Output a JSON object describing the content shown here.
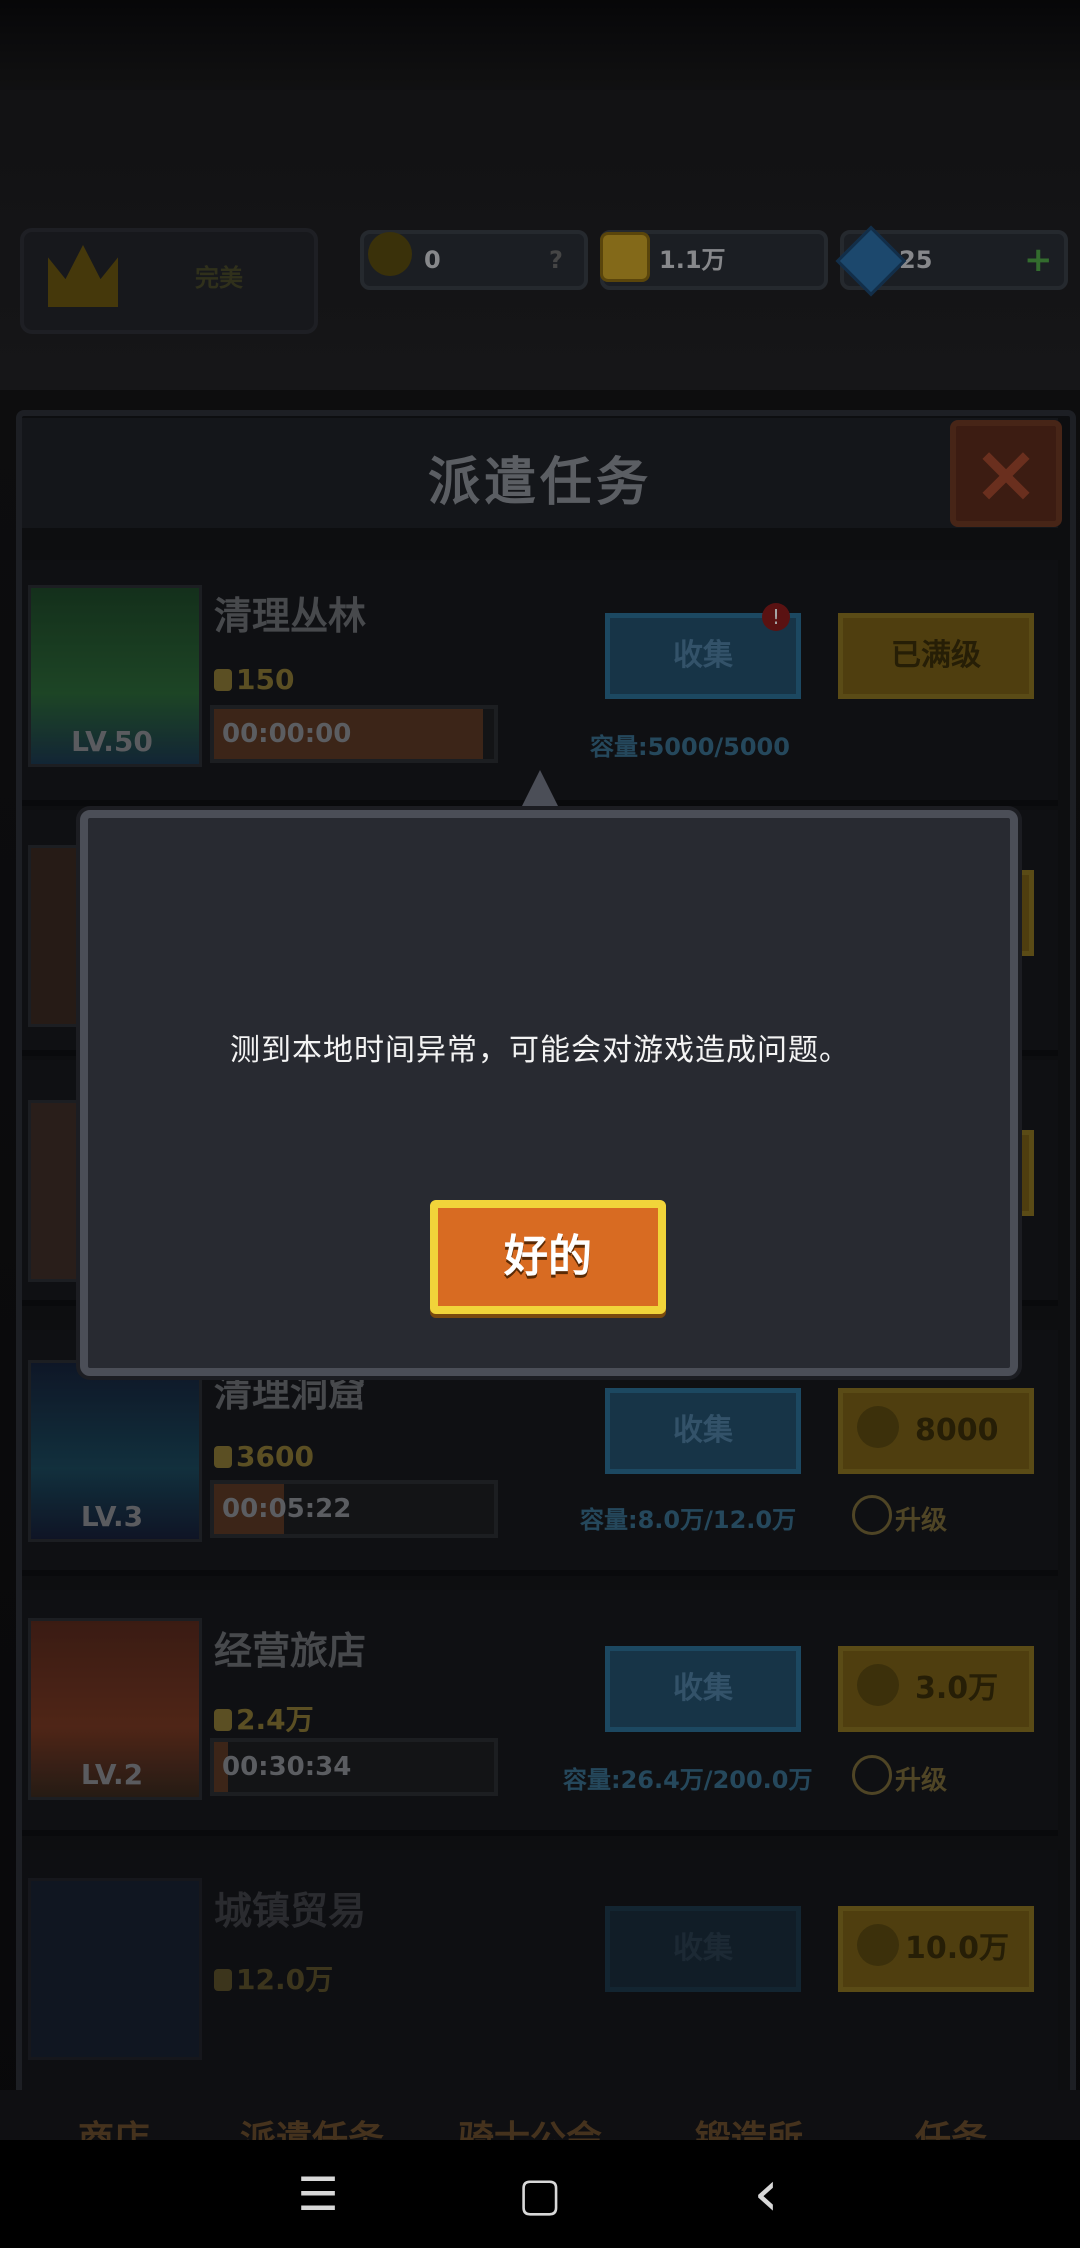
{
  "header": {
    "crown_label": "完美",
    "trophy_value": "0",
    "trophy_hint": "?",
    "coin_value": "1.1万",
    "gem_value": "25",
    "gem_add": "+"
  },
  "panel": {
    "title": "派遣任务",
    "close_icon": "×"
  },
  "rows": [
    {
      "name": "清理丛林",
      "level": "LV.50",
      "reward": "150",
      "timer": "00:00:00",
      "timer_fill": 1.0,
      "collect": "收集",
      "action": "已满级",
      "capacity": "容量:5000/5000",
      "upgrade": "",
      "alert": "!"
    },
    {
      "name": "清理洞窟",
      "level": "LV.3",
      "reward": "3600",
      "timer": "00:05:22",
      "timer_fill": 0.25,
      "collect": "收集",
      "action": "8000",
      "capacity": "容量:8.0万/12.0万",
      "upgrade": "升级"
    },
    {
      "name": "经营旅店",
      "level": "LV.2",
      "reward": "2.4万",
      "timer": "00:30:34",
      "timer_fill": 0.05,
      "collect": "收集",
      "action": "3.0万",
      "capacity": "容量:26.4万/200.0万",
      "upgrade": "升级"
    },
    {
      "name": "城镇贸易",
      "level": "",
      "reward": "12.0万",
      "timer": "",
      "timer_fill": 0.0,
      "collect": "收集",
      "action": "10.0万",
      "capacity": "",
      "upgrade": ""
    }
  ],
  "bottom_nav": [
    "商店",
    "派遣任务",
    "骑士公会",
    "锻造所",
    "任务"
  ],
  "dialog": {
    "message": "测到本地时间异常，可能会对游戏造成问题。",
    "ok_label": "好的"
  },
  "system_nav": {
    "menu_icon": "☰",
    "home_icon": "▢",
    "back_icon": "‹"
  }
}
